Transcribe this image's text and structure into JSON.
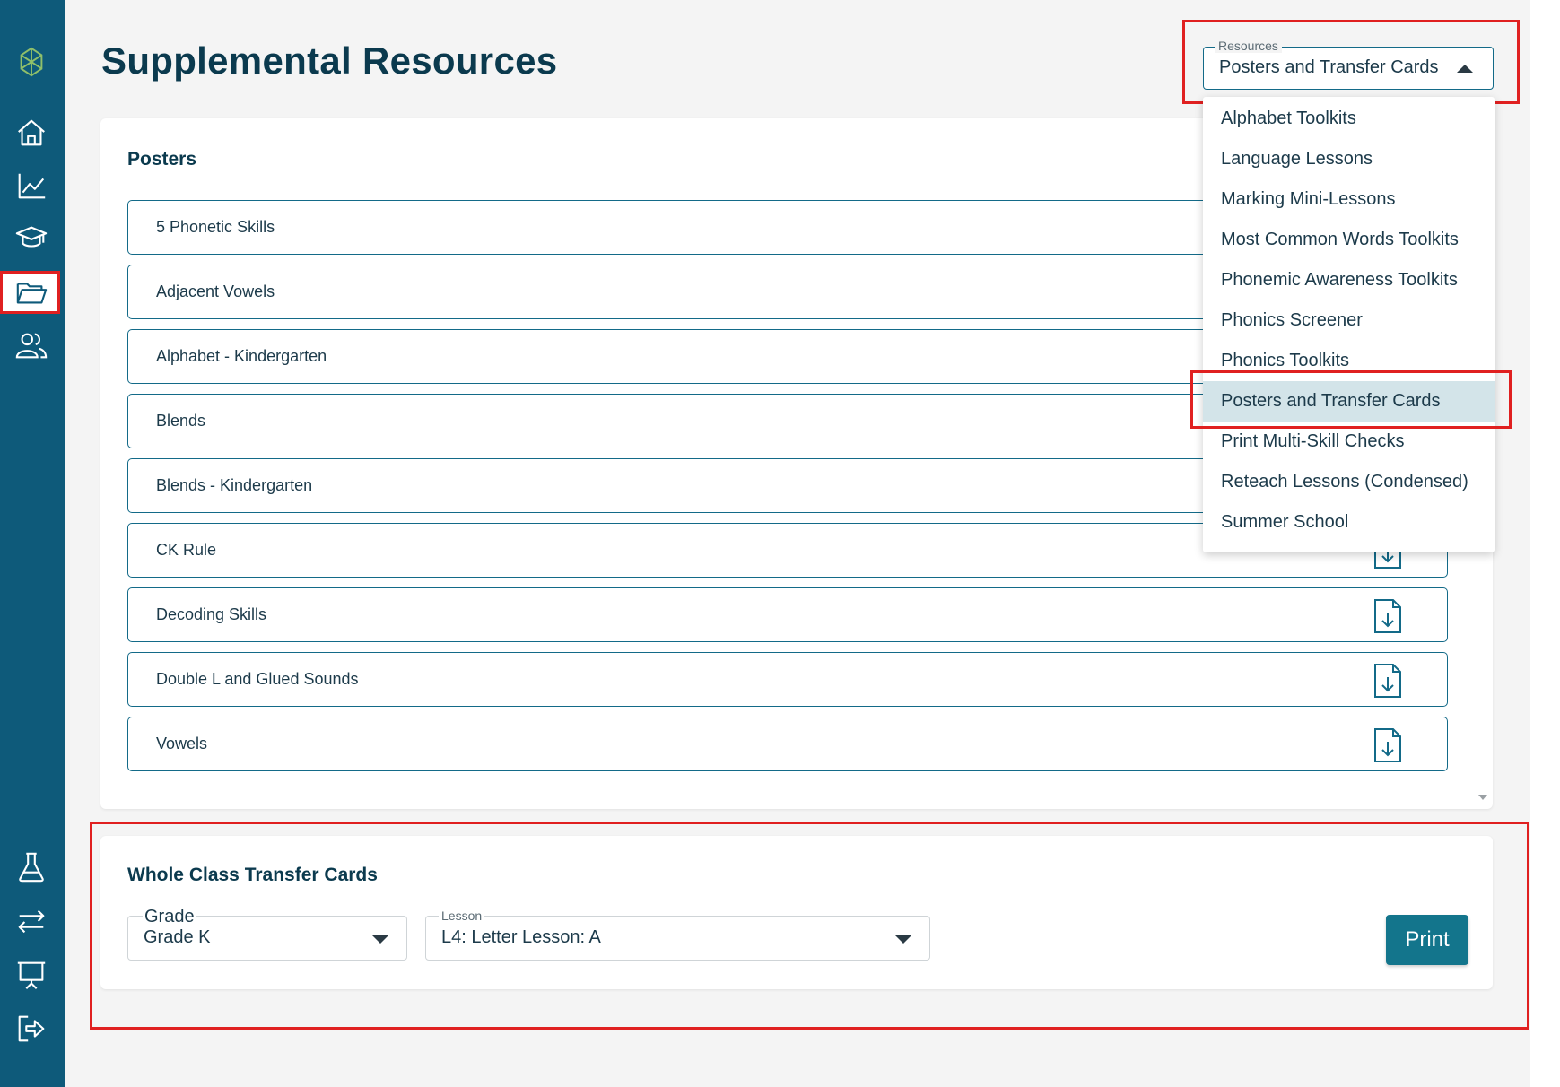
{
  "sidebar": {
    "items": [
      {
        "icon": "logo-icon"
      },
      {
        "icon": "home-icon"
      },
      {
        "icon": "chart-icon"
      },
      {
        "icon": "graduation-cap-icon"
      },
      {
        "icon": "folder-icon",
        "active": true
      },
      {
        "icon": "users-icon"
      },
      {
        "icon": "flask-icon"
      },
      {
        "icon": "transfer-icon"
      },
      {
        "icon": "presentation-icon"
      },
      {
        "icon": "logout-icon"
      }
    ]
  },
  "page": {
    "title": "Supplemental Resources"
  },
  "resources_select": {
    "label": "Resources",
    "value": "Posters and Transfer Cards",
    "options": [
      "Alphabet Toolkits",
      "Language Lessons",
      "Marking Mini-Lessons",
      "Most Common Words Toolkits",
      "Phonemic Awareness Toolkits",
      "Phonics Screener",
      "Phonics Toolkits",
      "Posters and Transfer Cards",
      "Print Multi-Skill Checks",
      "Reteach Lessons (Condensed)",
      "Summer School"
    ],
    "selected_index": 7
  },
  "posters": {
    "title": "Posters",
    "items": [
      "5 Phonetic Skills",
      "Adjacent Vowels",
      "Alphabet - Kindergarten",
      "Blends",
      "Blends - Kindergarten",
      "CK Rule",
      "Decoding Skills",
      "Double L and Glued Sounds",
      "Vowels"
    ]
  },
  "transfer_cards": {
    "title": "Whole Class Transfer Cards",
    "grade_label": "Grade",
    "grade_value": "Grade K",
    "lesson_label": "Lesson",
    "lesson_value": "L4: Letter Lesson: A",
    "print_label": "Print"
  },
  "colors": {
    "sidebar": "#0e5a7a",
    "accent": "#13758c",
    "highlight": "#e02020",
    "selected_option": "#d3e4e9"
  }
}
